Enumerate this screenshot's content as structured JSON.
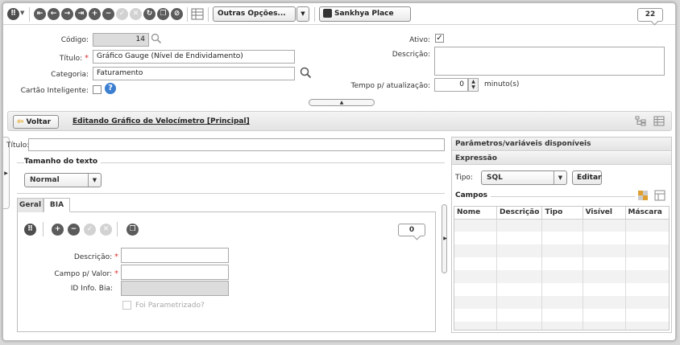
{
  "toolbar": {
    "more_options_label": "Outras Opções...",
    "place_label": "Sankhya Place",
    "count_badge": "22"
  },
  "form": {
    "codigo_label": "Código:",
    "codigo_value": "14",
    "titulo_label": "Título:",
    "titulo_value": "Gráfico Gauge (Nível de Endividamento)",
    "categoria_label": "Categoria:",
    "categoria_value": "Faturamento",
    "cartao_label": "Cartão Inteligente:",
    "ativo_label": "Ativo:",
    "ativo_checked": "✓",
    "descricao_label": "Descrição:",
    "tempo_label": "Tempo p/ atualização:",
    "tempo_value": "0",
    "tempo_unit": "minuto(s)"
  },
  "editbar": {
    "back_label": "Voltar",
    "title": "Editando Gráfico de Velocímetro [Principal]"
  },
  "left": {
    "titulo_label": "Título:",
    "tamanho_title": "Tamanho do texto",
    "tamanho_value": "Normal",
    "tabs": [
      {
        "label": "Geral"
      },
      {
        "label": "BIA"
      }
    ],
    "bia_badge": "0",
    "descricao_label": "Descrição:",
    "campo_label": "Campo p/ Valor:",
    "idinfo_label": "ID Info. Bia:",
    "foi_label": "Foi Parametrizado?"
  },
  "right": {
    "params_title": "Parâmetros/variáveis disponíveis",
    "expressao_title": "Expressão",
    "tipo_label": "Tipo:",
    "tipo_value": "SQL",
    "editar_label": "Editar",
    "campos_title": "Campos",
    "columns": [
      "Nome",
      "Descrição",
      "Tipo",
      "Visível",
      "Máscara"
    ]
  }
}
